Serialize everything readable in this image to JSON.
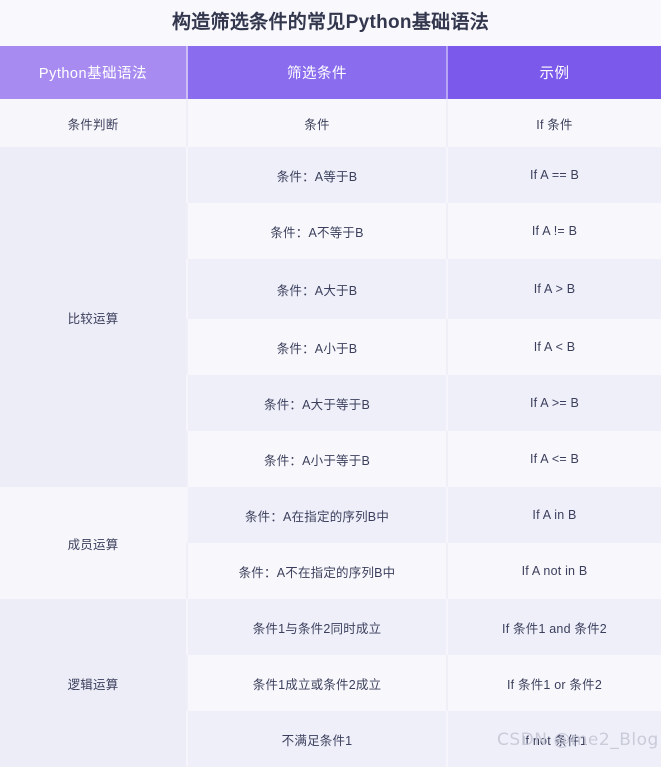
{
  "title": "构造筛选条件的常见Python基础语法",
  "table": {
    "headers": [
      "Python基础语法",
      "筛选条件",
      "示例"
    ],
    "header_colors": [
      "#a78bf0",
      "#8a6cee",
      "#7b59ea"
    ],
    "groups": [
      {
        "category": "条件判断",
        "tone": "light",
        "rows": [
          {
            "condition": "条件",
            "example": "If 条件"
          }
        ]
      },
      {
        "category": "比较运算",
        "tone": "lav",
        "rows": [
          {
            "condition": "条件：A等于B",
            "example": "If A == B"
          },
          {
            "condition": "条件：A不等于B",
            "example": "If A != B"
          },
          {
            "condition": "条件：A大于B",
            "example": "If A > B"
          },
          {
            "condition": "条件：A小于B",
            "example": "If A < B"
          },
          {
            "condition": "条件：A大于等于B",
            "example": "If A >= B"
          },
          {
            "condition": "条件：A小于等于B",
            "example": "If A <= B"
          }
        ]
      },
      {
        "category": "成员运算",
        "tone": "light",
        "rows": [
          {
            "condition": "条件：A在指定的序列B中",
            "example": "If A in B"
          },
          {
            "condition": "条件：A不在指定的序列B中",
            "example": "If A not in B"
          }
        ]
      },
      {
        "category": "逻辑运算",
        "tone": "lav",
        "rows": [
          {
            "condition": "条件1与条件2同时成立",
            "example": "If 条件1 and 条件2"
          },
          {
            "condition": "条件1成立或条件2成立",
            "example": "If 条件1 or 条件2"
          },
          {
            "condition": "不满足条件1",
            "example": "If not 条件1"
          }
        ]
      }
    ]
  },
  "watermark": "CSDN @me2_Blog"
}
